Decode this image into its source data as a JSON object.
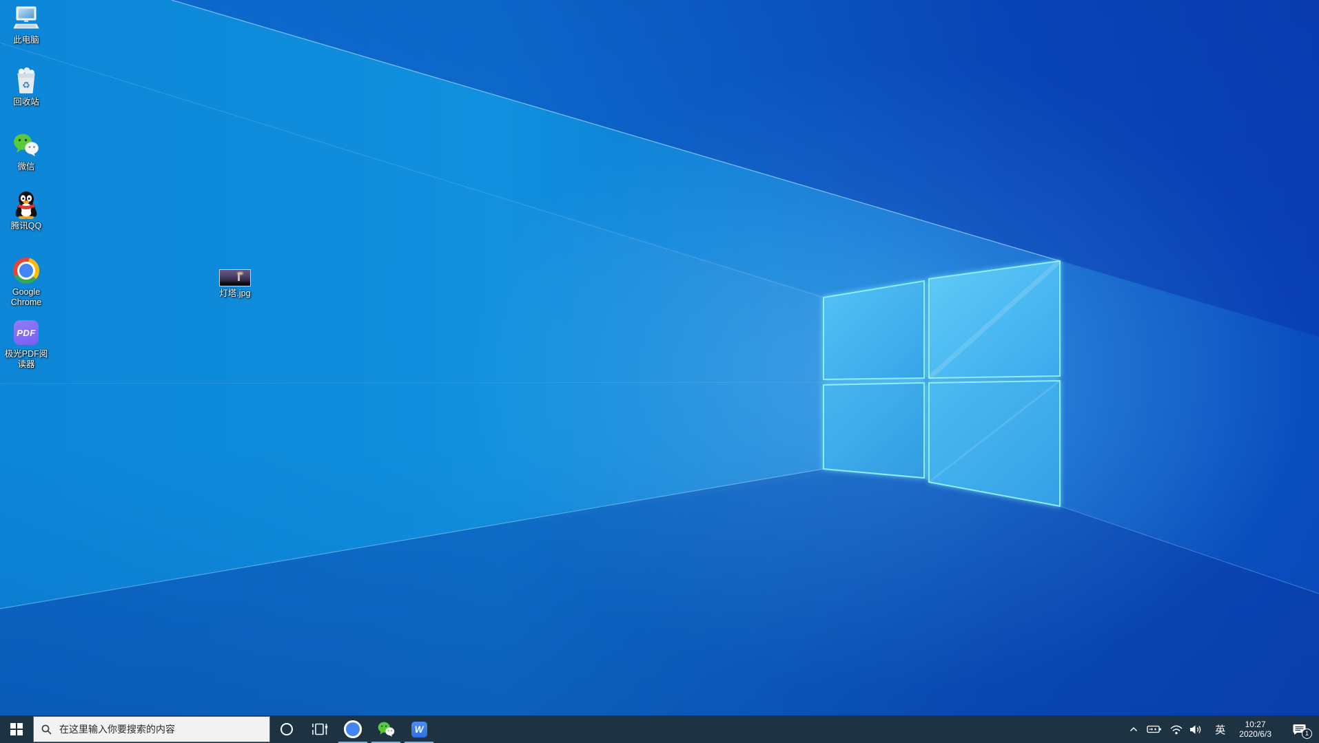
{
  "desktop": {
    "icons": [
      {
        "id": "this-pc",
        "label": "此电脑"
      },
      {
        "id": "recycle-bin",
        "label": "回收站"
      },
      {
        "id": "wechat",
        "label": "微信"
      },
      {
        "id": "qq",
        "label": "腾讯QQ"
      },
      {
        "id": "chrome",
        "label": "Google Chrome"
      },
      {
        "id": "pdf-reader",
        "label": "极光PDF阅读器"
      }
    ],
    "pdf_badge": "PDF",
    "files": [
      {
        "id": "lighthouse-jpg",
        "label": "灯塔.jpg"
      }
    ]
  },
  "taskbar": {
    "search_placeholder": "在这里输入你要搜索的内容",
    "wps_letter": "W",
    "tray": {
      "ime_label": "英",
      "time": "10:27",
      "date": "2020/6/3",
      "notification_count": "1"
    }
  },
  "colors": {
    "taskbar_bg": "#1d3342",
    "search_bg": "#f2f2f2",
    "indicator": "#7db4d8",
    "wallpaper_accent": "#0d86d8",
    "logo_edge": "#8deeff"
  }
}
